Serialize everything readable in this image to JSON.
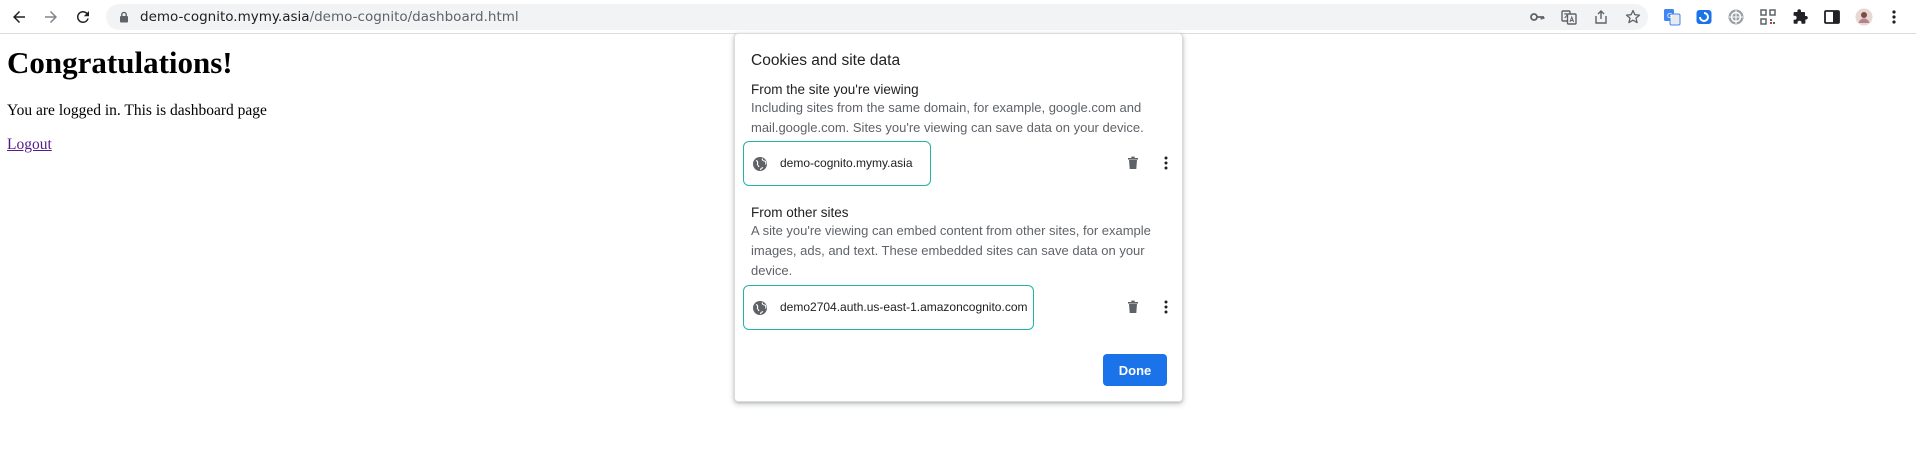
{
  "browser": {
    "url_host": "demo-cognito.mymy.asia",
    "url_path": "/demo-cognito/dashboard.html",
    "accent_color": "#1a73e8"
  },
  "page": {
    "heading": "Congratulations!",
    "message": "You are logged in. This is dashboard page",
    "logout_link": "Logout"
  },
  "cookies_dialog": {
    "title": "Cookies and site data",
    "first_party": {
      "title": "From the site you're viewing",
      "description": "Including sites from the same domain, for example, google.com and mail.google.com. Sites you're viewing can save data on your device.",
      "site": "demo-cognito.mymy.asia"
    },
    "third_party": {
      "title": "From other sites",
      "description": "A site you're viewing can embed content from other sites, for example images, ads, and text. These embedded sites can save data on your device.",
      "site": "demo2704.auth.us-east-1.amazoncognito.com"
    },
    "done_label": "Done",
    "highlight_color": "#1fb5a1"
  }
}
